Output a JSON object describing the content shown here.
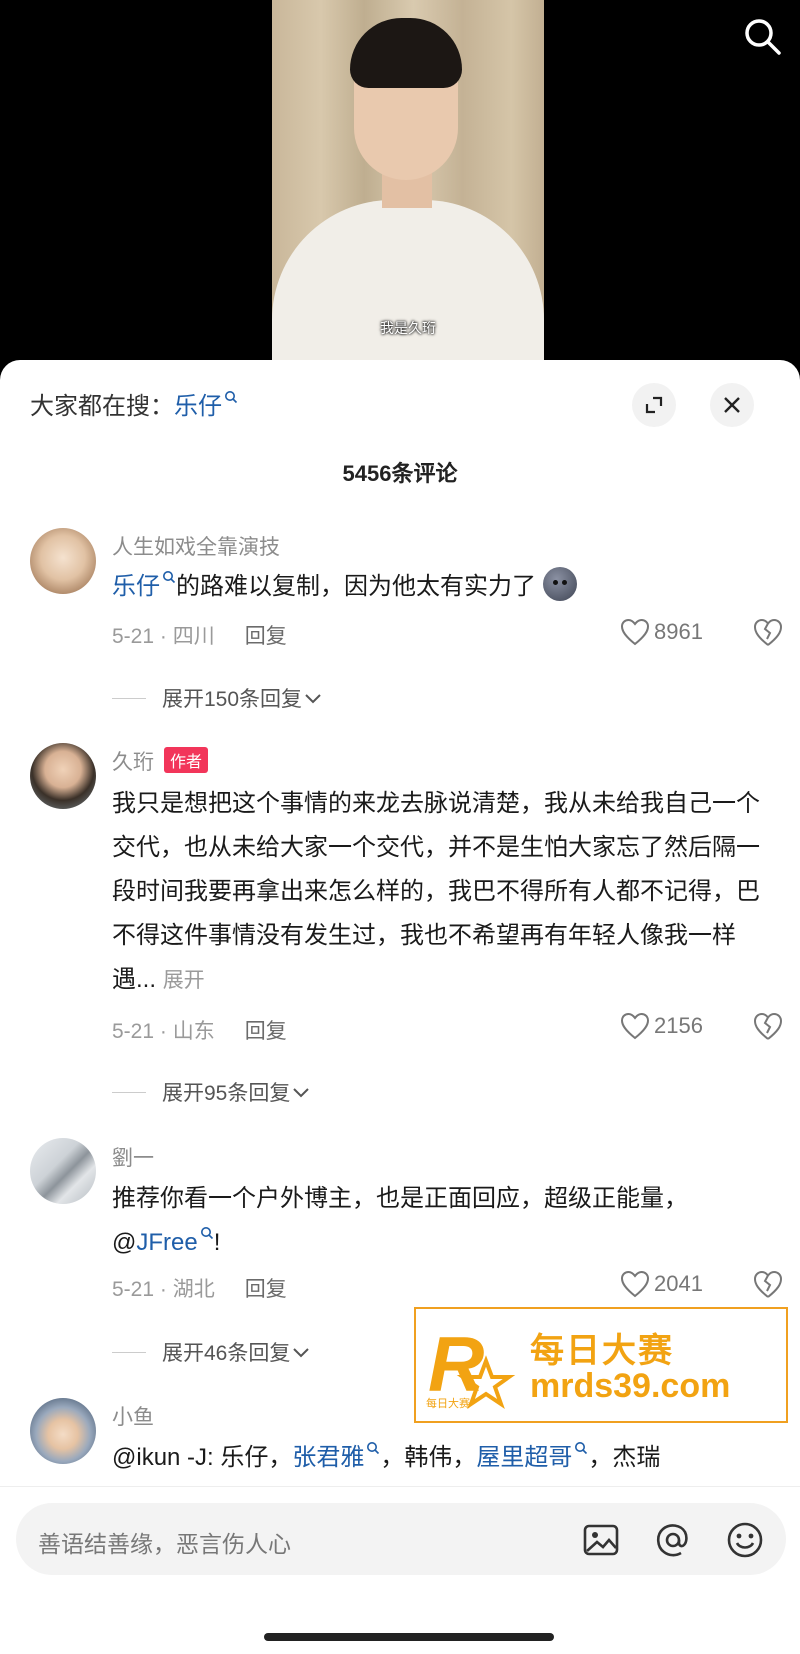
{
  "video": {
    "subtitle": "我是久珩"
  },
  "sheet": {
    "search_prefix": "大家都在搜：",
    "search_keyword": "乐仔",
    "comment_count_title": "5456条评论"
  },
  "comments": [
    {
      "username": "人生如戏全靠演技",
      "text_keyword": "乐仔",
      "text": "的路难以复制，因为他太有实力了",
      "date_location": "5-21 · 四川",
      "reply_label": "回复",
      "likes": "8961",
      "expand_label": "展开150条回复"
    },
    {
      "username": "久珩",
      "badge": "作者",
      "text": "我只是想把这个事情的来龙去脉说清楚，我从未给我自己一个交代，也从未给大家一个交代，并不是生怕大家忘了然后隔一段时间我要再拿出来怎么样的，我巴不得所有人都不记得，巴不得这件事情没有发生过，我也不希望再有年轻人像我一样遇...",
      "more_label": "展开",
      "date_location": "5-21 · 山东",
      "reply_label": "回复",
      "likes": "2156",
      "expand_label": "展开95条回复"
    },
    {
      "username": "劉一",
      "text": "推荐你看一个户外博主，也是正面回应，超级正能量，",
      "mention_prefix": "@",
      "mention_keyword": "JFree",
      "mention_suffix": "!",
      "date_location": "5-21 · 湖北",
      "reply_label": "回复",
      "likes": "2041",
      "expand_label": "展开46条回复"
    },
    {
      "username": "小鱼",
      "text_part1": "@ikun -J: 乐仔，",
      "kw1": "张君雅",
      "text_part2": "，韩伟，",
      "kw2": "屋里超哥",
      "text_part3": "，杰瑞"
    }
  ],
  "watermark": {
    "line1": "每日大赛",
    "line2": "mrds39.com",
    "logo_letter": "R",
    "logo_small": "每日大赛"
  },
  "input": {
    "placeholder": "善语结善缘，恶言伤人心"
  },
  "icons": {
    "top_search": "search-icon",
    "collapse": "collapse-icon",
    "close": "close-icon",
    "heart": "heart-icon",
    "dislike": "broken-heart-icon",
    "image": "image-icon",
    "at": "at-icon",
    "emoji": "emoji-icon"
  },
  "colors": {
    "link_blue": "#1f5ea9",
    "author_badge": "#f2355a",
    "watermark_orange": "#f2a312"
  }
}
